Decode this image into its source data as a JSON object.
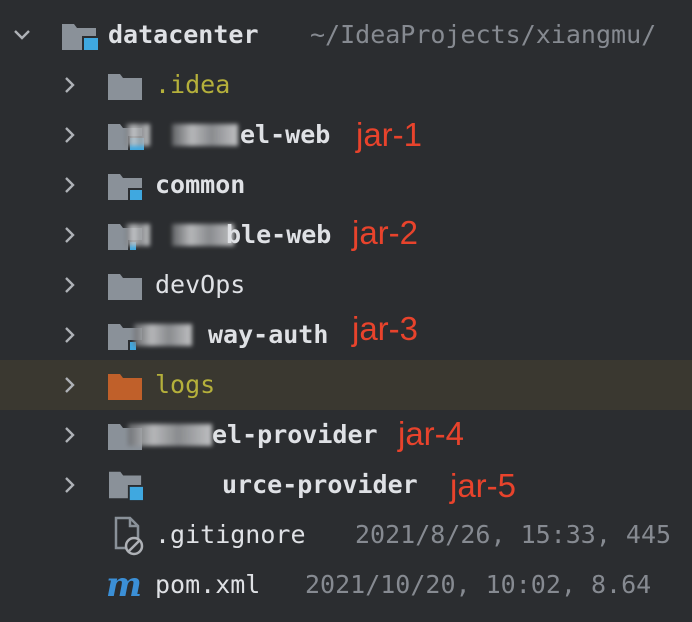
{
  "root": {
    "name": "datacenter",
    "path": "~/IdeaProjects/xiangmu/"
  },
  "items": [
    {
      "label": ".idea"
    },
    {
      "label": "el-web",
      "annotation": "jar-1"
    },
    {
      "label": "common"
    },
    {
      "label": "ble-web",
      "annotation": "jar-2"
    },
    {
      "label": "devOps"
    },
    {
      "label": "way-auth",
      "annotation": "jar-3"
    },
    {
      "label": "logs"
    },
    {
      "label": "el-provider",
      "annotation": "jar-4"
    },
    {
      "label": "urce-provider",
      "annotation": "jar-5"
    },
    {
      "label": ".gitignore",
      "meta": "2021/8/26, 15:33, 445"
    },
    {
      "label": "pom.xml",
      "meta": "2021/10/20, 10:02, 8.64"
    }
  ],
  "colors": {
    "background": "#2b2d30",
    "text": "#dfe1e5",
    "excluded_text": "#b5b03b",
    "meta_text": "#868a91",
    "folder_gray": "#8a9199",
    "module_blue": "#3fa8e0",
    "logs_folder": "#c0602a",
    "annotation_red": "#e8432c",
    "selected_row": "#3a3830"
  },
  "icons": {
    "expand": "chevron-right-icon",
    "collapse": "chevron-down-icon",
    "folder": "folder-icon",
    "module": "module-folder-icon",
    "gitignore": "ignored-file-icon",
    "maven": "maven-icon"
  }
}
